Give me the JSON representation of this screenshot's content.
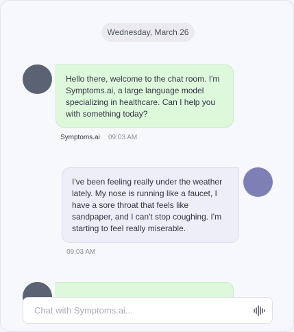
{
  "chat": {
    "date_label": "Wednesday, March 26",
    "messages": [
      {
        "sender": "Symptoms.ai",
        "text": "Hello there, welcome to the chat room. I'm Symptoms.ai, a large language model specializing in healthcare. Can I help you with something today?",
        "time": "09:03 AM"
      },
      {
        "sender": "",
        "text": "I've been feeling really under the weather lately. My nose is running like a faucet, I have a sore throat that feels like sandpaper, and I can't stop coughing. I'm starting to feel really miserable.",
        "time": "09:03 AM"
      }
    ]
  },
  "composer": {
    "placeholder": "Chat with Symptoms.ai...",
    "value": "",
    "voice_icon": "audio-waveform-icon"
  },
  "colors": {
    "bot_bubble": "#def8dc",
    "user_bubble": "#eeeef9",
    "bot_avatar": "#5a6273",
    "user_avatar": "#7e7fb4"
  }
}
